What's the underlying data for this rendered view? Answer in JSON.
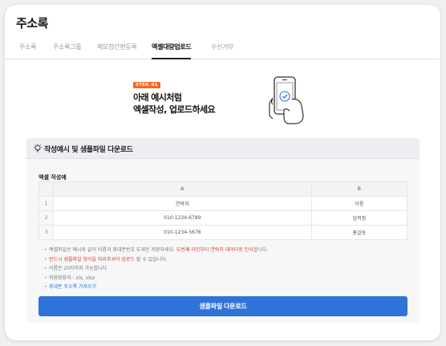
{
  "page": {
    "title": "주소록"
  },
  "tabs": [
    {
      "label": "주소록",
      "active": false
    },
    {
      "label": "주소록그룹",
      "active": false
    },
    {
      "label": "메모장간편등록",
      "active": false
    },
    {
      "label": "엑셀대량업로드",
      "active": true
    },
    {
      "label": "수신거부",
      "active": false
    }
  ],
  "hero": {
    "step": "STEP. 01",
    "line1": "아래 예시처럼",
    "line2": "엑셀작성, 업로드하세요"
  },
  "guide": {
    "title": "작성예시 및 샘플파일 다운로드",
    "example_label": "엑셀 작성예",
    "columns": [
      "A",
      "B"
    ],
    "rows": [
      {
        "num": "1",
        "a": "연락처",
        "b": "이름"
      },
      {
        "num": "2",
        "a": "010-1234-6789",
        "b": "임꺽정"
      },
      {
        "num": "3",
        "a": "010-1234-5678",
        "b": "홍길동"
      }
    ],
    "notes": {
      "n1_text": "엑셀파일은 예시와 같이 이름과 휴대폰번호 두개만 저장하세요. ",
      "n1_red": "두번째 라인부터 연락처 데이터로 인식",
      "n1_tail": "합니다.",
      "n2_red": "반드시 샘플파일 형식을 따라주셔야 업로드",
      "n2_tail": " 할 수 있습니다.",
      "n3": "이름은 20자까지 가능합니다.",
      "n4": "허용확장자 : xls, xlsx",
      "n5_link": "휴대폰 주소록 가져오기"
    },
    "download_label": "샘플파일 다운로드"
  },
  "colors": {
    "accent": "#2f73d9",
    "step_badge": "#f26a22",
    "warning": "#e23c2b",
    "link": "#2b6fd6"
  }
}
